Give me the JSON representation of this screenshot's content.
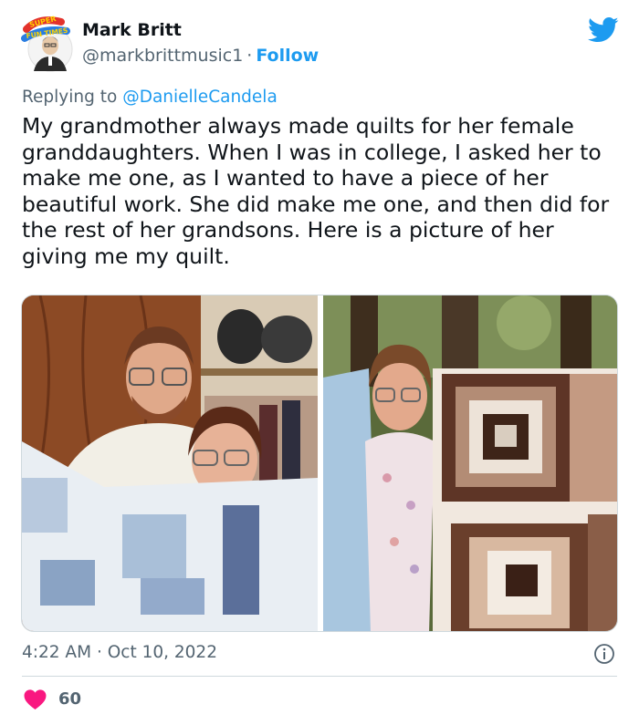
{
  "tweet": {
    "author_name": "Mark Britt",
    "author_handle": "@markbrittmusic1",
    "separator": "·",
    "follow_label": "Follow",
    "avatar_badge_text": "SUPER FUN TIMES",
    "replying_prefix": "Replying to",
    "replying_to": "@DanielleCandela",
    "text": "My grandmother always made quilts for her female granddaughters. When I was in college, I asked her to make me one, as I wanted to have a piece of her beautiful work. She did make me one, and then did for the rest of her grandsons. Here is a picture of her giving me my quilt.",
    "time": "4:22 AM",
    "date": "Oct 10, 2022",
    "likes": "60"
  },
  "colors": {
    "brand_blue": "#1d9bf0",
    "like_pink": "#f91880",
    "muted_text": "#536471"
  },
  "icons": {
    "platform": "bird-logo-icon",
    "info": "info-icon",
    "like": "heart-icon"
  }
}
